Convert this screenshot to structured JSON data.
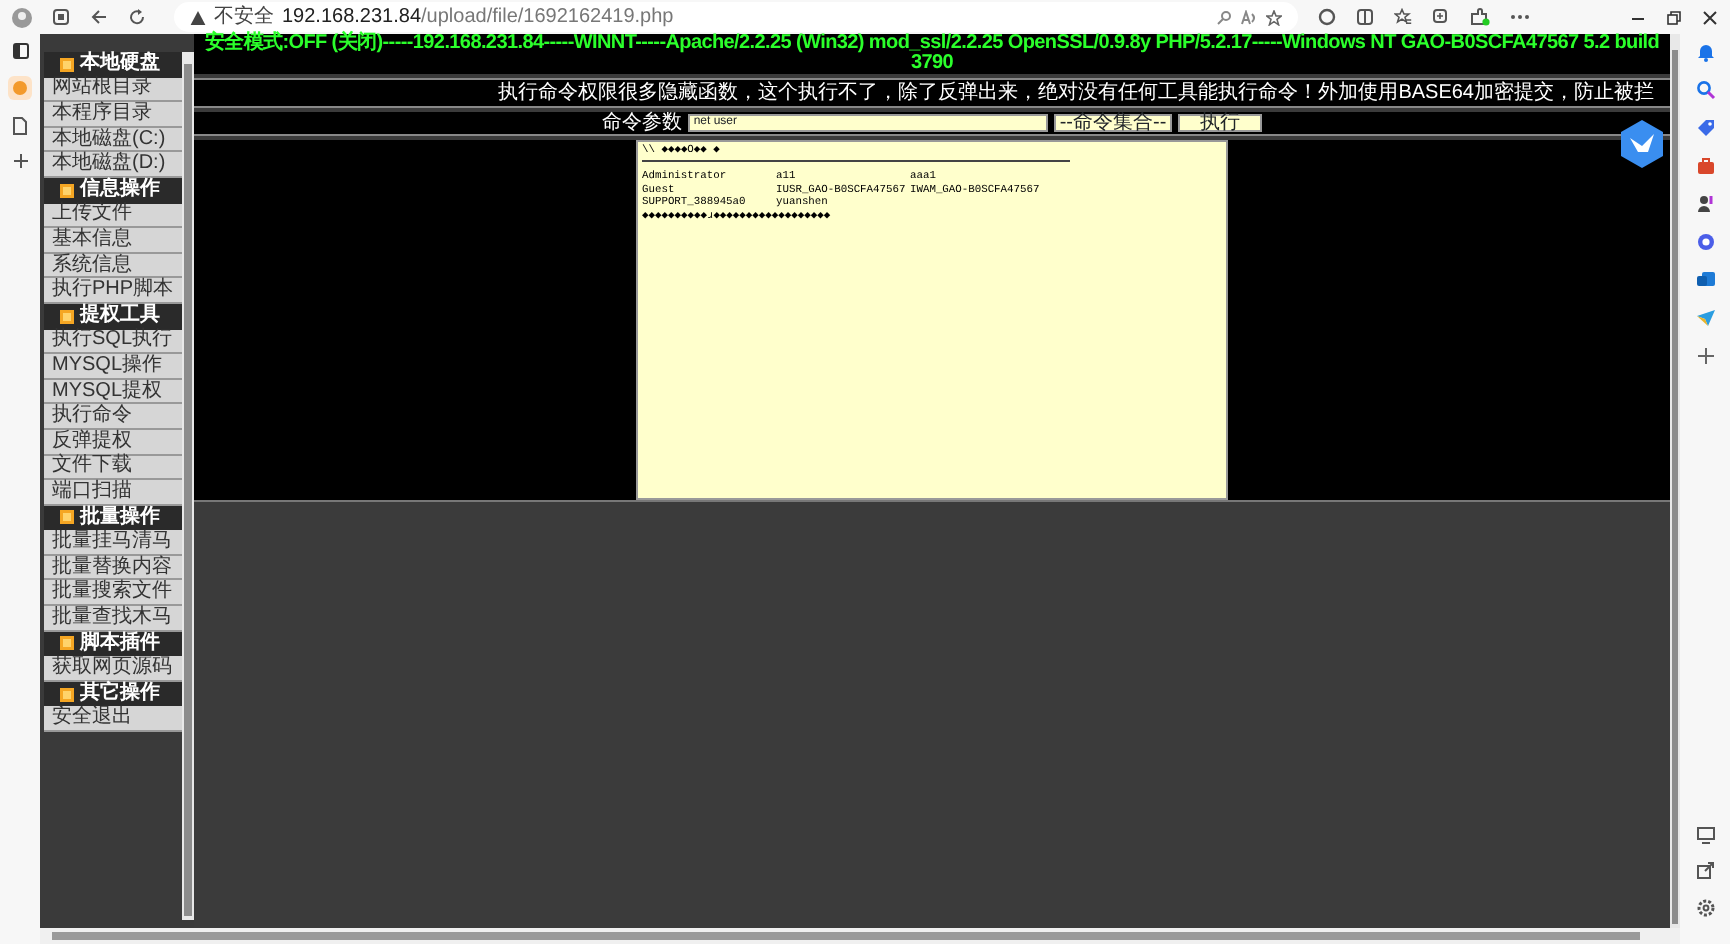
{
  "browser": {
    "security_label": "不安全",
    "url_host": "192.168.231.84",
    "url_path": "/upload/file/1692162419.php"
  },
  "sidebar": {
    "sections": [
      {
        "title": "本地硬盘",
        "items": [
          "网站根目录",
          "本程序目录",
          "本地磁盘(C:)",
          "本地磁盘(D:)"
        ]
      },
      {
        "title": "信息操作",
        "items": [
          "上传文件",
          "基本信息",
          "系统信息",
          "执行PHP脚本"
        ]
      },
      {
        "title": "提权工具",
        "items": [
          "执行SQL执行",
          "MYSQL操作",
          "MYSQL提权",
          "执行命令",
          "反弹提权",
          "文件下载",
          "端口扫描"
        ]
      },
      {
        "title": "批量操作",
        "items": [
          "批量挂马清马",
          "批量替换内容",
          "批量搜索文件",
          "批量查找木马"
        ]
      },
      {
        "title": "脚本插件",
        "items": [
          "获取网页源码"
        ]
      },
      {
        "title": "其它操作",
        "items": [
          "安全退出"
        ]
      }
    ]
  },
  "status_line": "安全模式:OFF (关闭)-----192.168.231.84-----WINNT-----Apache/2.2.25 (Win32) mod_ssl/2.2.25 OpenSSL/0.9.8y PHP/5.2.17-----Windows NT GAO-B0SCFA47567 5.2 build 3790",
  "notice": "执行命令权限很多隐藏函数，这个执行不了，除了反弹出来，绝对没有任何工具能执行命令！外加使用BASE64加密提交，防止被拦",
  "command": {
    "label": "命令参数",
    "value": "net user",
    "preset_select": "--命令集合--",
    "run_button": "执行"
  },
  "output": [
    {
      "kind": "text",
      "text": "\\\\ ◆◆◆◆O◆◆ ◆"
    },
    {
      "kind": "rule"
    },
    {
      "kind": "row",
      "cells": [
        "Administrator",
        "a11",
        "aaa1"
      ]
    },
    {
      "kind": "row",
      "cells": [
        "Guest",
        "IUSR_GAO-B0SCFA47567",
        "IWAM_GAO-B0SCFA47567"
      ]
    },
    {
      "kind": "row",
      "cells": [
        "SUPPORT_388945a0",
        "yuanshen"
      ]
    },
    {
      "kind": "text",
      "text": "◆◆◆◆◆◆◆◆◆◆ɹ◆◆◆◆◆◆◆◆◆◆◆◆◆◆◆◆◆◆"
    }
  ]
}
